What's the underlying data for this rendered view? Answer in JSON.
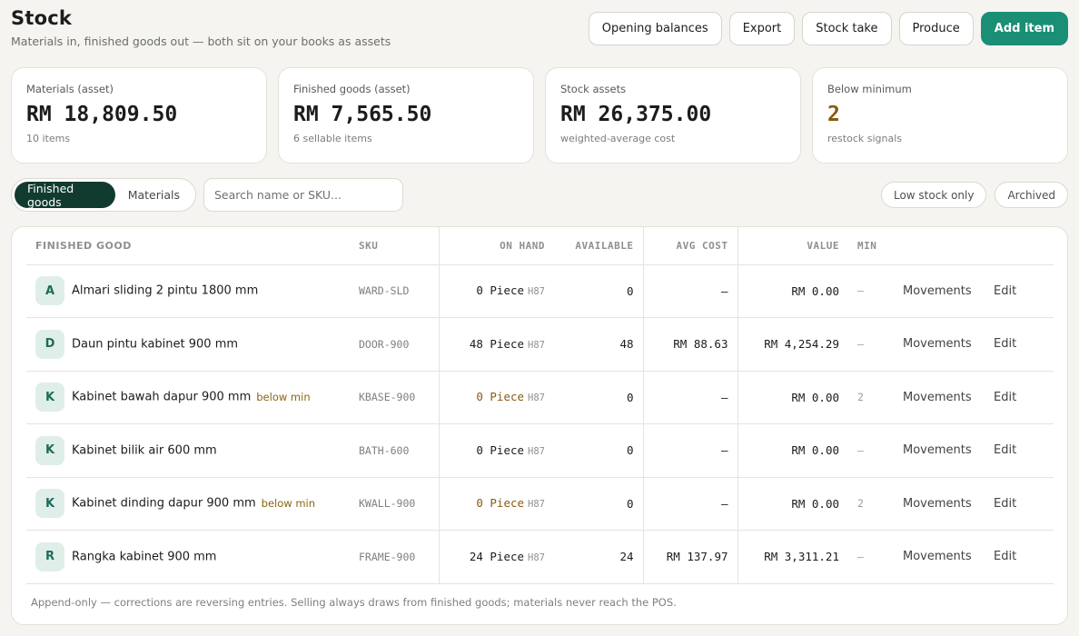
{
  "header": {
    "title": "Stock",
    "subtitle": "Materials in, finished goods out — both sit on your books as assets",
    "actions": [
      "Opening balances",
      "Export",
      "Stock take",
      "Produce",
      "Add item"
    ]
  },
  "cards": [
    {
      "label": "Materials (asset)",
      "value": "RM 18,809.50",
      "sub": "10 items"
    },
    {
      "label": "Finished goods (asset)",
      "value": "RM 7,565.50",
      "sub": "6 sellable items"
    },
    {
      "label": "Stock assets",
      "value": "RM 26,375.00",
      "sub": "weighted-average cost"
    },
    {
      "label": "Below minimum",
      "value": "2",
      "sub": "restock signals"
    }
  ],
  "filters": {
    "tabs": [
      "Finished goods",
      "Materials"
    ],
    "active_tab": "Finished goods",
    "search_placeholder": "Search name or SKU...",
    "search_value": "",
    "chips": [
      "Low stock only",
      "Archived"
    ]
  },
  "table": {
    "columns": [
      "FINISHED GOOD",
      "SKU",
      "ON HAND",
      "AVAILABLE",
      "AVG COST",
      "VALUE",
      "MIN"
    ],
    "rows": [
      {
        "initial": "A",
        "name": "Almari sliding 2 pintu 1800 mm",
        "badge": "",
        "sku": "WARD-SLD",
        "on_hand": "0 Piece",
        "unit": "H87",
        "available": "0",
        "avg_cost": "—",
        "value": "RM 0.00",
        "min": "—",
        "movements": "Movements",
        "edit": "Edit"
      },
      {
        "initial": "D",
        "name": "Daun pintu kabinet 900 mm",
        "badge": "",
        "sku": "DOOR-900",
        "on_hand": "48 Piece",
        "unit": "H87",
        "available": "48",
        "avg_cost": "RM 88.63",
        "value": "RM 4,254.29",
        "min": "—",
        "movements": "Movements",
        "edit": "Edit"
      },
      {
        "initial": "K",
        "name": "Kabinet bawah dapur 900 mm",
        "badge": "below min",
        "sku": "KBASE-900",
        "on_hand": "0 Piece",
        "unit": "H87",
        "available": "0",
        "avg_cost": "—",
        "value": "RM 0.00",
        "min": "2",
        "movements": "Movements",
        "edit": "Edit"
      },
      {
        "initial": "K",
        "name": "Kabinet bilik air 600 mm",
        "badge": "",
        "sku": "BATH-600",
        "on_hand": "0 Piece",
        "unit": "H87",
        "available": "0",
        "avg_cost": "—",
        "value": "RM 0.00",
        "min": "—",
        "movements": "Movements",
        "edit": "Edit"
      },
      {
        "initial": "K",
        "name": "Kabinet dinding dapur 900 mm",
        "badge": "below min",
        "sku": "KWALL-900",
        "on_hand": "0 Piece",
        "unit": "H87",
        "available": "0",
        "avg_cost": "—",
        "value": "RM 0.00",
        "min": "2",
        "movements": "Movements",
        "edit": "Edit"
      },
      {
        "initial": "R",
        "name": "Rangka kabinet 900 mm",
        "badge": "",
        "sku": "FRAME-900",
        "on_hand": "24 Piece",
        "unit": "H87",
        "available": "24",
        "avg_cost": "RM 137.97",
        "value": "RM 3,311.21",
        "min": "—",
        "movements": "Movements",
        "edit": "Edit"
      }
    ]
  },
  "footnote": "Append-only — corrections are reversing entries. Selling always draws from finished goods; materials never reach the POS.",
  "colors": {
    "accent": "#1a8f76",
    "active_tab": "#123b30",
    "warning": "#8a5a12"
  }
}
